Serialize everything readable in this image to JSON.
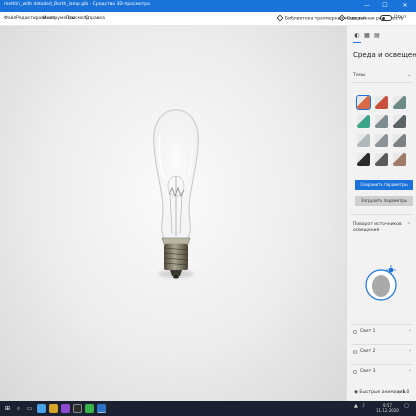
{
  "window": {
    "title": "metlitri_with detailed_Borth_lamp.glb - Средство 3D-просмотра",
    "controls": {
      "minimize": "—",
      "maximize": "☐",
      "close": "✕"
    }
  },
  "menu": {
    "items": [
      "Файл",
      "Редактирование",
      "Инструменты",
      "Просмотр",
      "Справка"
    ],
    "library_label": "Библиотека трехмерных моделей",
    "mixed_reality_label": "Смешанная реальность",
    "toggle_label": "Откл"
  },
  "panel": {
    "tabs": [
      "◐",
      "▦",
      "▤"
    ],
    "title": "Среда и освещение",
    "themes_label": "Темы",
    "save_button": "Сохранить параметры",
    "reset_button": "Загрузить параметры",
    "rotation_label": "Поворот источников освещения",
    "lights": [
      "Свет 1",
      "Свет 2",
      "Свет 3"
    ],
    "theme_colors": [
      [
        "#d86a4a",
        "#c9503c",
        "#6d8b86"
      ],
      [
        "#3aa58a",
        "#7f8c91",
        "#5b6367"
      ],
      [
        "#b0b8bb",
        "#8d9396",
        "#7a8084"
      ],
      [
        "#2a2a2a",
        "#5a5a5a",
        "#a17b6a"
      ]
    ]
  },
  "statusbar": {
    "animation_label": "Быстрые анимации",
    "zoom": "+ 1,0"
  },
  "taskbar": {
    "time": "9:57",
    "date": "11.12.2020"
  },
  "colors": {
    "accent": "#1a73d8",
    "taskbar": "#1b2130"
  }
}
